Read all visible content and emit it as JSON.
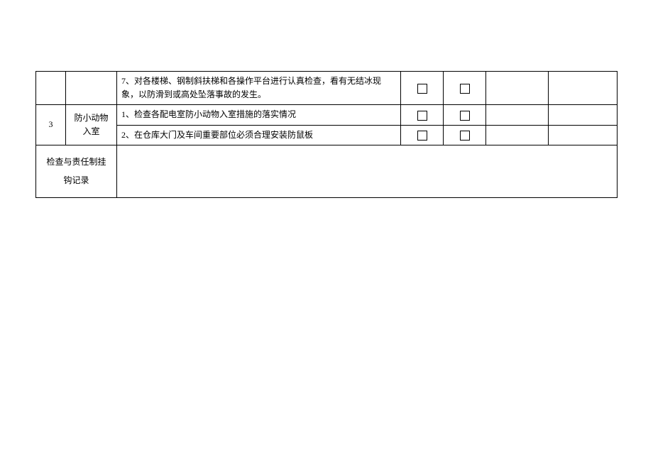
{
  "rows": [
    {
      "index": "",
      "category": "",
      "content": "7、对各楼梯、钢制斜扶梯和各操作平台进行认真检查，看有无结冰现象，以防滑到或高处坠落事故的发生。"
    },
    {
      "index": "3",
      "category": "防小动物入室",
      "content1": "1、检查各配电室防小动物入室措施的落实情况",
      "content2": "2、在仓库大门及车间重要部位必须合理安装防鼠板"
    }
  ],
  "footer": {
    "label_line1": "检查与责任制挂",
    "label_line2": "钩记录"
  }
}
